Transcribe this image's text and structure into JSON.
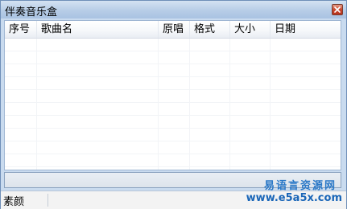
{
  "window": {
    "title": "伴奏音乐盒"
  },
  "listview": {
    "columns": [
      "序号",
      "歌曲名",
      "原唱",
      "格式",
      "大小",
      "日期"
    ],
    "rows": []
  },
  "statusbar": {
    "text": "素颜"
  },
  "watermark": {
    "line1": "易语言资源网",
    "line2": "www.e5a5x.com"
  },
  "colors": {
    "titlebar": "#b7cde7",
    "close_button": "#c8472e",
    "frame": "#c9dbef",
    "watermark": "#1a66b8"
  },
  "icons": {
    "close": "close-icon"
  }
}
